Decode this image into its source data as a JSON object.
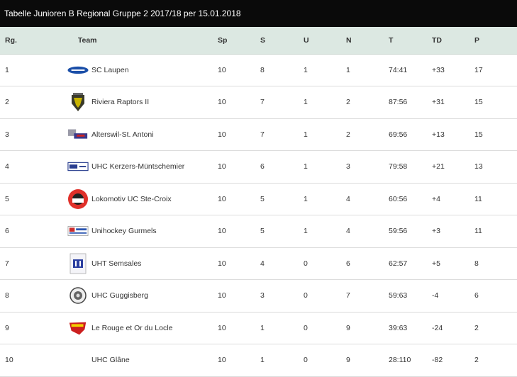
{
  "title": "Tabelle Junioren B Regional Gruppe 2 2017/18 per 15.01.2018",
  "columns": {
    "rank": "Rg.",
    "team": "Team",
    "sp": "Sp",
    "s": "S",
    "u": "U",
    "n": "N",
    "t": "T",
    "td": "TD",
    "p": "P"
  },
  "rows": [
    {
      "rank": "1",
      "team": "SC Laupen",
      "logo": "sc-laupen-logo",
      "sp": "10",
      "s": "8",
      "u": "1",
      "n": "1",
      "t": "74:41",
      "td": "+33",
      "p": "17"
    },
    {
      "rank": "2",
      "team": "Riviera Raptors II",
      "logo": "riviera-raptors-logo",
      "sp": "10",
      "s": "7",
      "u": "1",
      "n": "2",
      "t": "87:56",
      "td": "+31",
      "p": "15"
    },
    {
      "rank": "3",
      "team": "Alterswil-St. Antoni",
      "logo": "alterswil-logo",
      "sp": "10",
      "s": "7",
      "u": "1",
      "n": "2",
      "t": "69:56",
      "td": "+13",
      "p": "15"
    },
    {
      "rank": "4",
      "team": "UHC Kerzers-Müntschemier",
      "logo": "uhc-kerzers-logo",
      "sp": "10",
      "s": "6",
      "u": "1",
      "n": "3",
      "t": "79:58",
      "td": "+21",
      "p": "13"
    },
    {
      "rank": "5",
      "team": "Lokomotiv UC Ste-Croix",
      "logo": "lokomotiv-logo",
      "sp": "10",
      "s": "5",
      "u": "1",
      "n": "4",
      "t": "60:56",
      "td": "+4",
      "p": "11"
    },
    {
      "rank": "6",
      "team": "Unihockey Gurmels",
      "logo": "gurmels-logo",
      "sp": "10",
      "s": "5",
      "u": "1",
      "n": "4",
      "t": "59:56",
      "td": "+3",
      "p": "11"
    },
    {
      "rank": "7",
      "team": "UHT Semsales",
      "logo": "semsales-logo",
      "sp": "10",
      "s": "4",
      "u": "0",
      "n": "6",
      "t": "62:57",
      "td": "+5",
      "p": "8"
    },
    {
      "rank": "8",
      "team": "UHC Guggisberg",
      "logo": "guggisberg-logo",
      "sp": "10",
      "s": "3",
      "u": "0",
      "n": "7",
      "t": "59:63",
      "td": "-4",
      "p": "6"
    },
    {
      "rank": "9",
      "team": "Le Rouge et Or du Locle",
      "logo": "le-rouge-et-or-logo",
      "sp": "10",
      "s": "1",
      "u": "0",
      "n": "9",
      "t": "39:63",
      "td": "-24",
      "p": "2"
    },
    {
      "rank": "10",
      "team": "UHC Glâne",
      "logo": "",
      "sp": "10",
      "s": "1",
      "u": "0",
      "n": "9",
      "t": "28:110",
      "td": "-82",
      "p": "2"
    }
  ]
}
